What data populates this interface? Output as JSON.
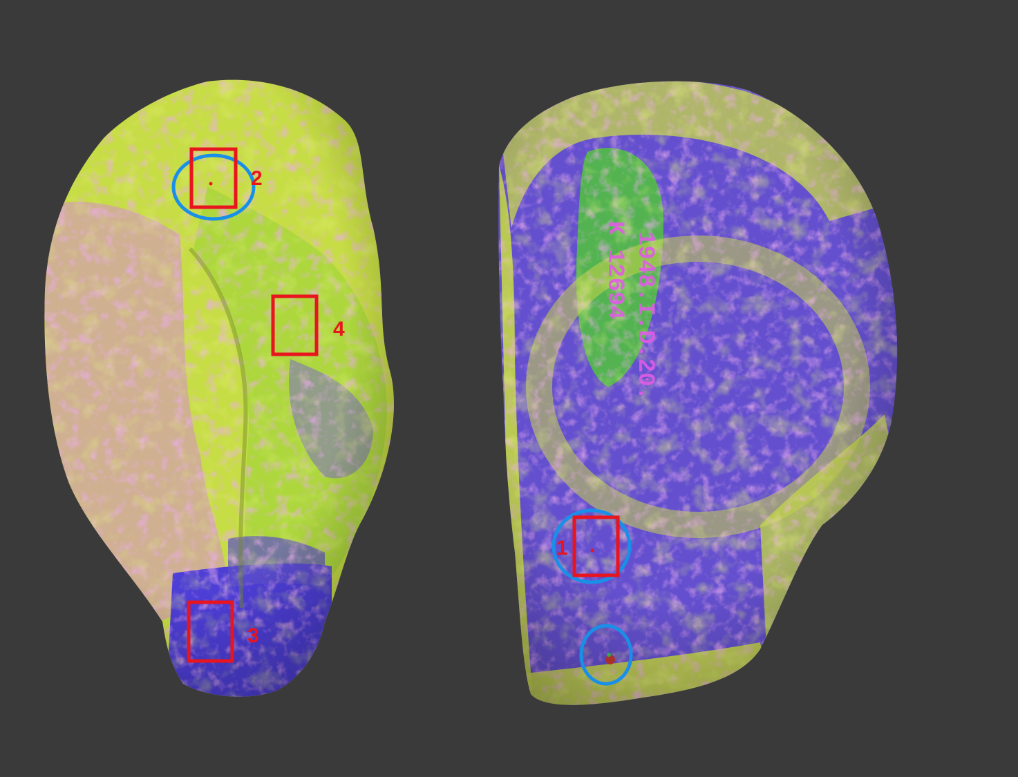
{
  "background_color": "#3a3a3a",
  "annotation_colors": {
    "box": "#e8141e",
    "circle": "#1a8fe8",
    "label": "#e8141e"
  },
  "specimen_colors": {
    "yellow_green": "#c9e03a",
    "magenta": "#d66ad8",
    "blue_violet": "#5a44d4",
    "green": "#7ed23a"
  },
  "region_labels": {
    "r1": "1",
    "r2": "2",
    "r3": "3",
    "r4": "4"
  },
  "specimen_inscription": {
    "line1": "1948.I.D.20.",
    "line2": "K 12694"
  }
}
